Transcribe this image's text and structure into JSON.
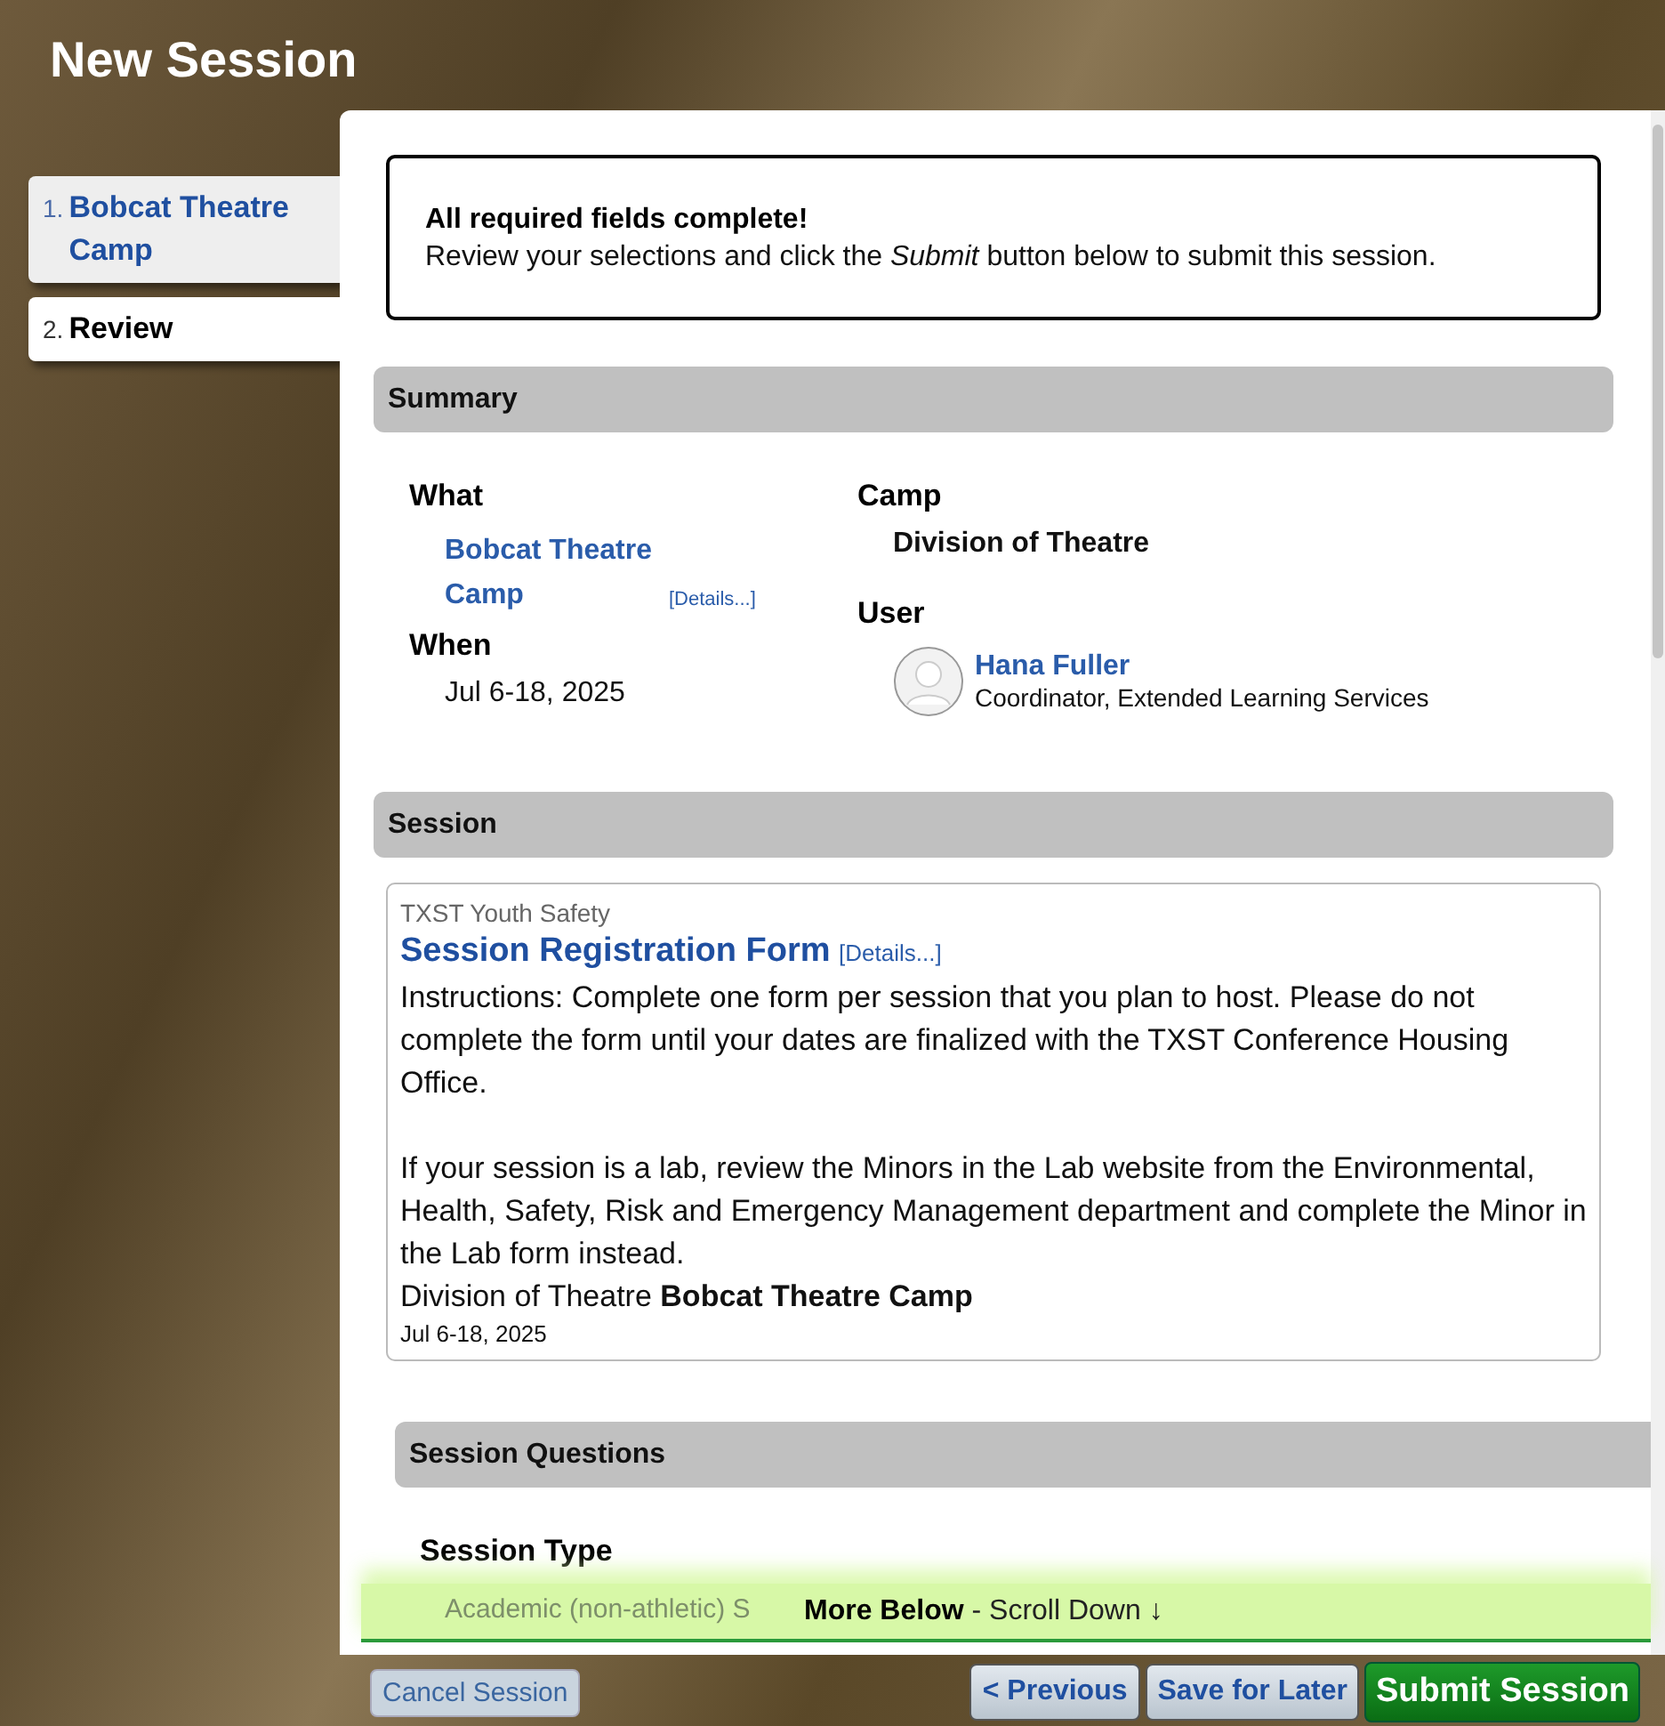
{
  "window": {
    "title": "New Session"
  },
  "steps": [
    {
      "number": "1.",
      "label": "Bobcat Theatre Camp",
      "selected": false
    },
    {
      "number": "2.",
      "label": "Review",
      "selected": true
    }
  ],
  "alert": {
    "title": "All required fields complete!",
    "message": "Review your selections and click the *Submit* button below to submit this session."
  },
  "summary": {
    "title": "Summary",
    "what_label": "What",
    "what": "Bobcat Theatre Camp",
    "what_details": "[Details...]",
    "when_label": "When",
    "when": "Jul 6-18, 2025",
    "camp_label": "Camp",
    "camp": "Division of Theatre",
    "user_label": "User",
    "user_name": "Hana Fuller",
    "user_role": "Coordinator, Extended Learning Services"
  },
  "session": {
    "title": "Session",
    "category": "TXST Youth Safety",
    "form_title": "Session Registration Form",
    "details": "[Details...]",
    "paragraphs": [
      "Instructions: Complete one form per session that you plan to host. Please do not complete the form until your dates are finalized with the TXST Conference Housing Office.",
      "If your session is a lab, review the Minors in the Lab website from the Environmental, Health, Safety, Risk and Emergency Management department and complete the Minor in the Lab form instead."
    ],
    "footer": "Division of Theatre **Bobcat Theatre Camp**",
    "date": "Jul 6-18, 2025"
  },
  "questions": {
    "title": "Session Questions",
    "items": [
      {
        "label": "Session Type",
        "answer": "Academic (non-athletic) S"
      }
    ]
  },
  "banner": {
    "text": "**More Below** - Scroll Down ↓"
  },
  "buttons": [
    {
      "label": "Cancel Session",
      "kind": "cancel"
    },
    {
      "label": "< Previous",
      "kind": "nav"
    },
    {
      "label": "Save for Later",
      "kind": "nav"
    },
    {
      "label": "Submit Session",
      "kind": "primary"
    }
  ]
}
